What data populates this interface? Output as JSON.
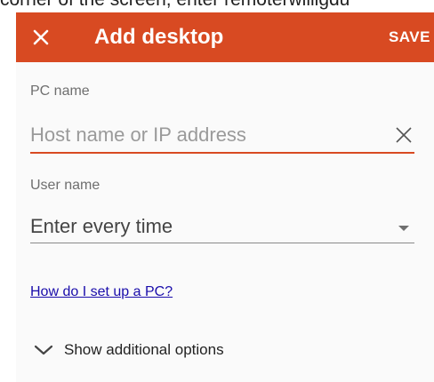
{
  "partial_caption": "corner of the screen, enter remoterwilligdu",
  "appbar": {
    "title": "Add desktop",
    "save_label": "SAVE",
    "close_icon": "close-icon",
    "color": "#d84a22"
  },
  "pc_name": {
    "label": "PC name",
    "value": "",
    "placeholder": "Host name or IP address",
    "clear_icon": "clear-icon"
  },
  "user_name": {
    "label": "User name",
    "selected": "Enter every time",
    "arrow_icon": "dropdown-arrow-icon"
  },
  "help_link": {
    "text": "How do I set up a PC?",
    "color": "#1a0dab"
  },
  "additional_options": {
    "label": "Show additional options",
    "icon": "chevron-down-icon"
  }
}
